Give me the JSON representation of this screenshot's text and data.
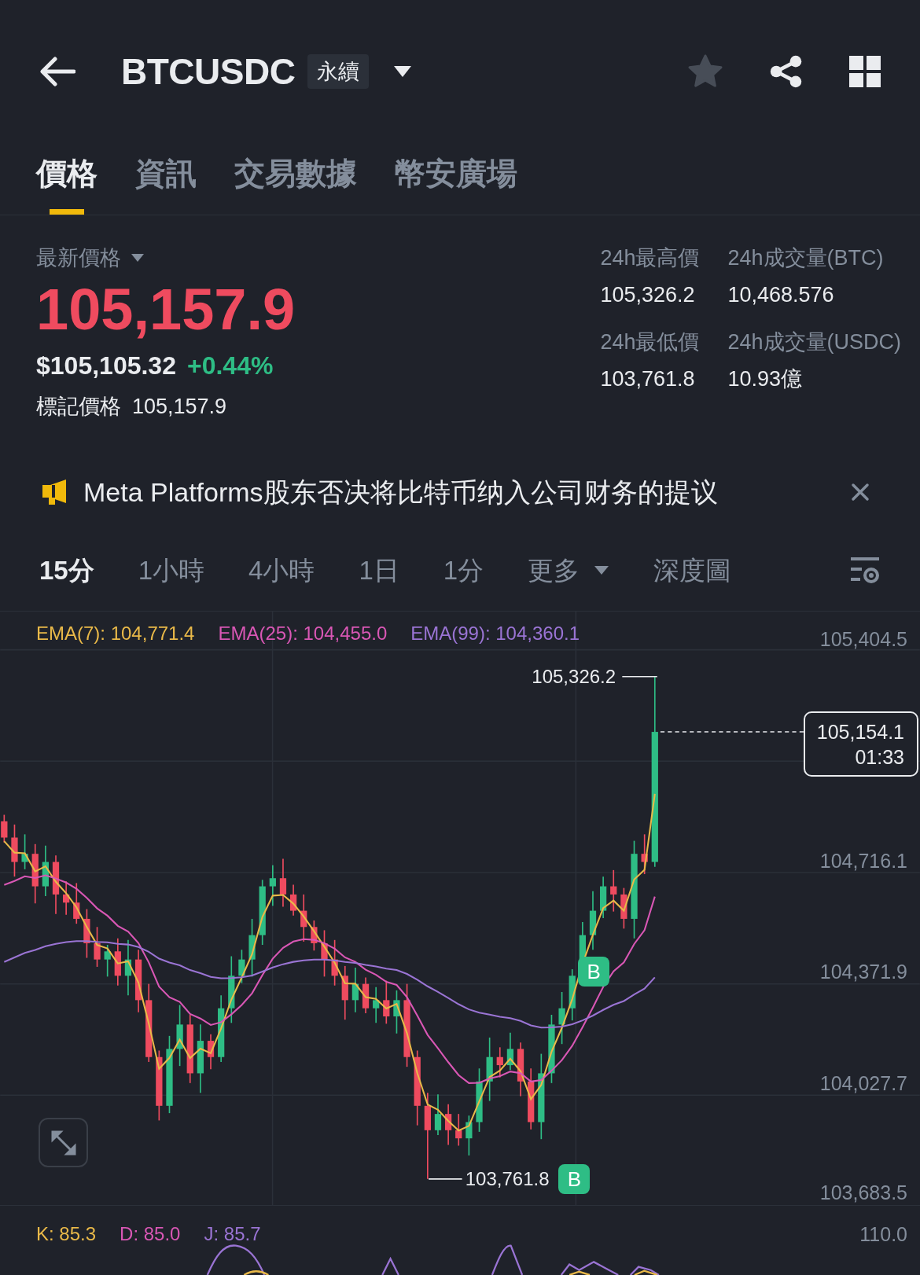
{
  "header": {
    "title": "BTCUSDC",
    "badge": "永續",
    "favorited": false
  },
  "tabs": [
    {
      "label": "價格",
      "selected": true
    },
    {
      "label": "資訊",
      "selected": false
    },
    {
      "label": "交易數據",
      "selected": false
    },
    {
      "label": "幣安廣場",
      "selected": false
    }
  ],
  "ticker": {
    "last_price_label": "最新價格",
    "last_price": "105,157.9",
    "usd_price": "$105,105.32",
    "change": "+0.44%",
    "mark_price_label": "標記價格",
    "mark_price": "105,157.9"
  },
  "stats": [
    {
      "label": "24h最高價",
      "value": "105,326.2"
    },
    {
      "label": "24h成交量(BTC)",
      "value": "10,468.576"
    },
    {
      "label": "24h最低價",
      "value": "103,761.8"
    },
    {
      "label": "24h成交量(USDC)",
      "value": "10.93億"
    }
  ],
  "news": {
    "text": "Meta Platforms股东否决将比特币纳入公司财务的提议"
  },
  "intervals": [
    {
      "label": "15分",
      "selected": true,
      "kind": "plain"
    },
    {
      "label": "1小時",
      "selected": false,
      "kind": "plain"
    },
    {
      "label": "4小時",
      "selected": false,
      "kind": "plain"
    },
    {
      "label": "1日",
      "selected": false,
      "kind": "plain"
    },
    {
      "label": "1分",
      "selected": false,
      "kind": "plain"
    },
    {
      "label": "更多",
      "selected": false,
      "kind": "dropdown"
    },
    {
      "label": "深度圖",
      "selected": false,
      "kind": "plain"
    }
  ],
  "indicators": [
    {
      "label": "EMA(7): 104,771.4",
      "color": "#e9b949"
    },
    {
      "label": "EMA(25): 104,455.0",
      "color": "#d957b5"
    },
    {
      "label": "EMA(99): 104,360.1",
      "color": "#9a74d4"
    }
  ],
  "price_axis": [
    "105,404.5",
    "104,716.1",
    "104,371.9",
    "104,027.7",
    "103,683.5"
  ],
  "high_label": "105,326.2",
  "low_label": "103,761.8",
  "current_price": {
    "price": "105,154.1",
    "countdown": "01:33"
  },
  "trade_markers": [
    {
      "label": "B"
    },
    {
      "label": "B"
    }
  ],
  "kdj": {
    "indicators": [
      {
        "label": "K: 85.3",
        "color": "#e9b949"
      },
      {
        "label": "D: 85.0",
        "color": "#d957b5"
      },
      {
        "label": "J: 85.7",
        "color": "#9a74d4"
      }
    ],
    "axis_label": "110.0"
  }
}
